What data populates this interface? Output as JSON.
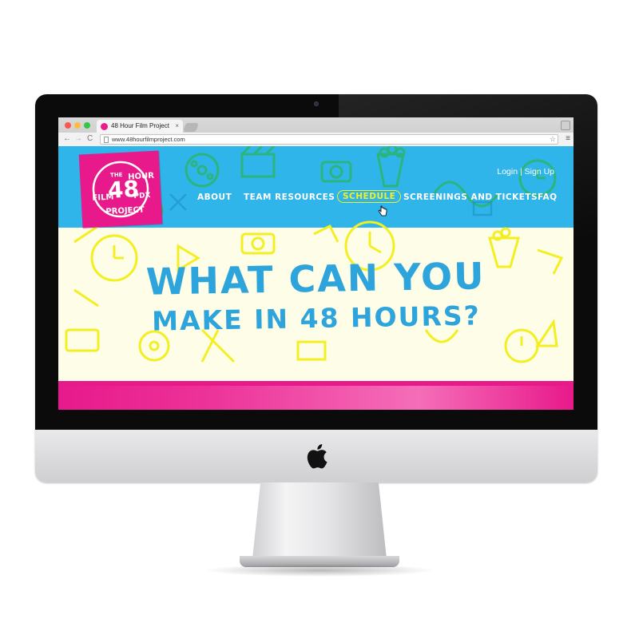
{
  "browser": {
    "tab_title": "48 Hour Film Project",
    "tab_close": "×",
    "url": "www.48hourfilmproject.com",
    "back_glyph": "←",
    "forward_glyph": "→",
    "reload_glyph": "C",
    "star_glyph": "☆",
    "menu_glyph": "≡"
  },
  "site": {
    "logo": {
      "alt": "The 48 Hour Film Project PDX"
    },
    "auth": {
      "login": "Login",
      "separator": " | ",
      "signup": "Sign Up"
    },
    "nav": [
      {
        "label": "ABOUT"
      },
      {
        "label": "TEAM RESOURCES"
      },
      {
        "label": "SCHEDULE",
        "active": true
      },
      {
        "label": "SCREENINGS AND TICKETS"
      },
      {
        "label": "FAQ"
      }
    ],
    "hero": {
      "line1": "WHAT CAN YOU",
      "line2": "MAKE IN 48 HOURS?"
    }
  },
  "colors": {
    "blue": "#2fb5ea",
    "pink": "#e8198b",
    "yellow": "#f3ef22",
    "green": "#2bb673",
    "headline_blue": "#2da4dc"
  },
  "icons": [
    "apple-logo-icon",
    "film-reel-icon",
    "clock-icon",
    "popcorn-icon",
    "camera-icon",
    "cursor-hand-icon"
  ]
}
